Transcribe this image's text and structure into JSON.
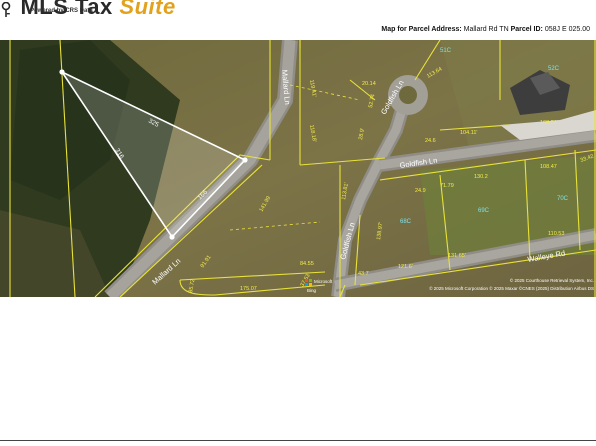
{
  "header": {
    "logo_text_main": "MLS Tax",
    "logo_text_accent": "Suite",
    "powered_by": "Powered by CRS Data",
    "map_label": "Map for Parcel Address:",
    "address": "Mallard Rd TN",
    "parcel_label": "Parcel ID:",
    "parcel_id": "058J E 025.00"
  },
  "map": {
    "roads": {
      "mallard_1": "Mallard Ln",
      "mallard_2": "Mallard Ln",
      "goldfish_1": "Goldfish Ln",
      "goldfish_2": "Goldfish Ln",
      "goldfish_3": "Goldfish Ln",
      "walleye": "Walleye Rd"
    },
    "parcel_labels": {
      "p51c": "51C",
      "p52c": "52C",
      "p68c": "68C",
      "p69c": "69C",
      "p70c": "70C"
    },
    "dimensions": {
      "d325": "325",
      "d316": "316",
      "d166": "166",
      "d141": "141.99",
      "d91": "91.91",
      "d85": "85.72",
      "d175": "175.07",
      "d84": "84.55",
      "d37": "37.53",
      "d119": "119.41'",
      "d118": "118.18'",
      "d28": "28.9'",
      "d113": "113.81'",
      "d20": "20.14",
      "d52": "52.74",
      "d113b": "113.64",
      "d24": "24.6",
      "d104": "104.11'",
      "d168": "168.51'",
      "d24b": "24.9",
      "d71": "71.79",
      "d130": "130.2",
      "d108": "108.47",
      "d33": "33.42",
      "d138": "138.97'",
      "d110": "110.53",
      "d121": "121.6'",
      "d131": "131.65'",
      "d43": "43.7"
    },
    "credits": {
      "microsoft": "Microsoft",
      "bing": "Bing",
      "copyright": "© 2025 Courthouse Retrieval System, Inc.",
      "attribution": "© 2025 Microsoft Corporation © 2025 Maxar ©CNES (2025) Distribution Airbus DS"
    }
  },
  "colors": {
    "parcel_lines": "#e8e23a",
    "selection": "#ffffff",
    "accent": "#e2a21e"
  }
}
